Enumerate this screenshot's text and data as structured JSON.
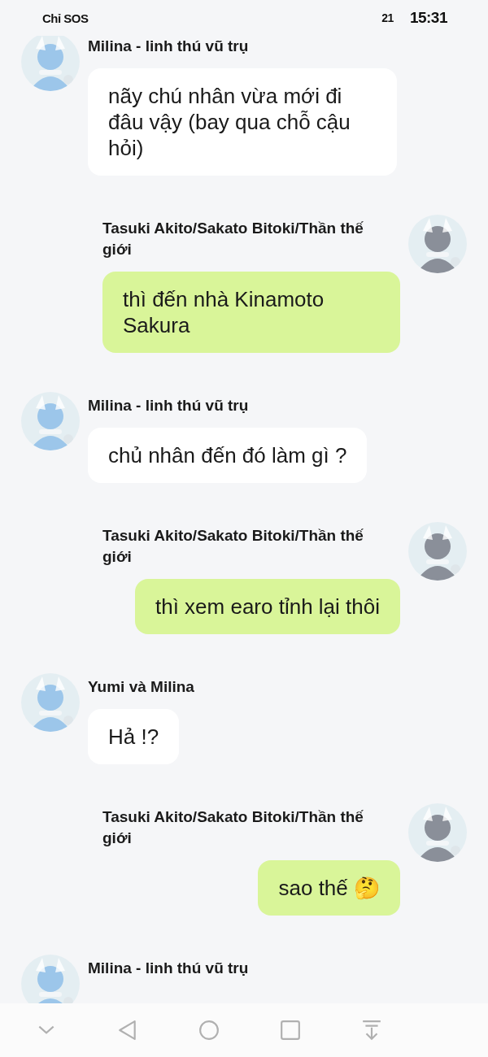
{
  "status_bar": {
    "carrier": "Chỉ SOS",
    "notification_count": "21",
    "time": "15:31"
  },
  "messages": [
    {
      "kind": "incoming",
      "sender": "Milina - linh thú vũ trụ",
      "text": "nãy chú nhân vừa mới đi đâu vậy (bay qua chỗ cậu hỏi)"
    },
    {
      "kind": "outgoing",
      "sender": "Tasuki Akito/Sakato Bitoki/Thần thế giới",
      "text": "thì đến nhà Kinamoto Sakura"
    },
    {
      "kind": "incoming",
      "sender": "Milina - linh thú vũ trụ",
      "text": "chủ nhân đến đó làm gì ?"
    },
    {
      "kind": "outgoing",
      "sender": "Tasuki Akito/Sakato Bitoki/Thần thế giới",
      "text": "thì xem earo tỉnh lại thôi"
    },
    {
      "kind": "incoming",
      "sender": "Yumi và Milina",
      "text": "Hả !?"
    },
    {
      "kind": "outgoing",
      "sender": "Tasuki Akito/Sakato Bitoki/Thần thế giới",
      "text": "sao thế 🤔"
    },
    {
      "kind": "incoming",
      "sender": "Milina - linh thú vũ trụ"
    }
  ]
}
